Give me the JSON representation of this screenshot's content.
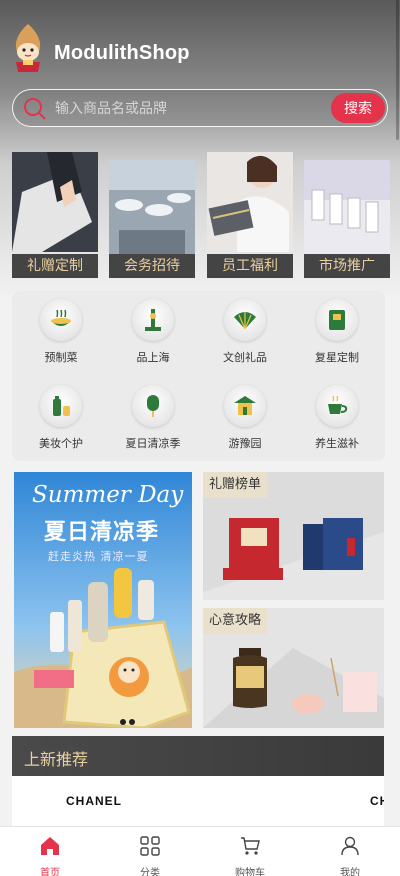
{
  "app": {
    "title": "ModulithShop"
  },
  "search": {
    "placeholder": "输入商品名或品牌",
    "button_label": "搜索"
  },
  "banners": [
    {
      "label": "礼赠定制"
    },
    {
      "label": "会务招待"
    },
    {
      "label": "员工福利"
    },
    {
      "label": "市场推广"
    }
  ],
  "categories": [
    {
      "label": "预制菜",
      "icon": "dish-icon"
    },
    {
      "label": "品上海",
      "icon": "tower-icon"
    },
    {
      "label": "文创礼品",
      "icon": "fan-icon"
    },
    {
      "label": "复星定制",
      "icon": "book-icon"
    },
    {
      "label": "美妆个护",
      "icon": "cosmetics-icon"
    },
    {
      "label": "夏日清凉季",
      "icon": "popsicle-icon"
    },
    {
      "label": "游豫园",
      "icon": "pavilion-icon"
    },
    {
      "label": "养生滋补",
      "icon": "teacup-icon"
    }
  ],
  "promo": {
    "title_en": "Summer Day",
    "title_cn": "夏日清凉季",
    "subtitle": "赶走炎热 清凉一夏"
  },
  "side_cards": [
    {
      "tag": "礼赠榜单"
    },
    {
      "tag": "心意攻略"
    }
  ],
  "new_section": {
    "label": "上新推荐"
  },
  "brands": [
    "CHANEL",
    "CH"
  ],
  "tabs": [
    {
      "label": "首页",
      "icon": "home-icon",
      "active": true
    },
    {
      "label": "分类",
      "icon": "grid-icon",
      "active": false
    },
    {
      "label": "购物车",
      "icon": "cart-icon",
      "active": false
    },
    {
      "label": "我的",
      "icon": "user-icon",
      "active": false
    }
  ],
  "colors": {
    "accent": "#e4334a",
    "gold": "#e9d0a0",
    "dark": "#444444"
  }
}
